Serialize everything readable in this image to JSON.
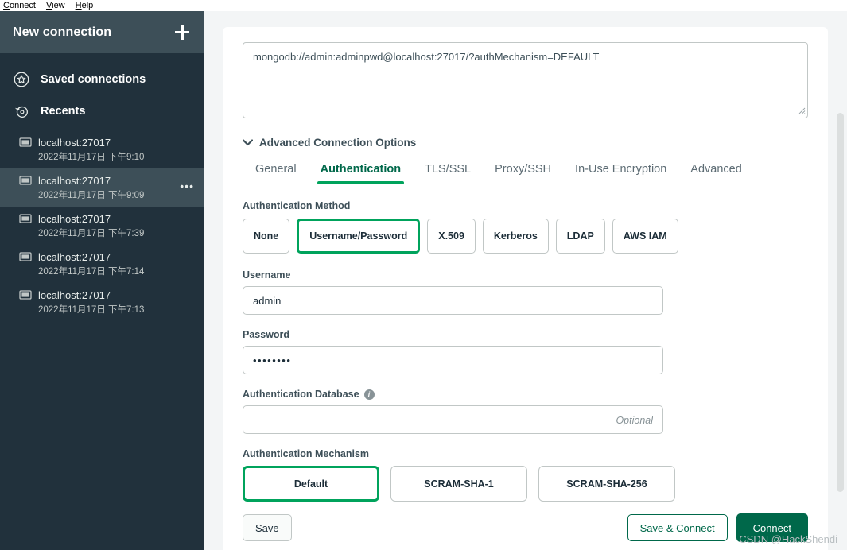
{
  "menubar": {
    "items": [
      {
        "mnemonic": "C",
        "rest": "onnect"
      },
      {
        "mnemonic": "V",
        "rest": "iew"
      },
      {
        "mnemonic": "H",
        "rest": "elp"
      }
    ]
  },
  "sidebar": {
    "header": {
      "title": "New connection",
      "add_icon": "plus-icon"
    },
    "sections": [
      {
        "label": "Saved connections",
        "icon": "star-circle-icon"
      },
      {
        "label": "Recents",
        "icon": "history-rewind-icon"
      }
    ],
    "recents": [
      {
        "name": "localhost:27017",
        "date": "2022年11月17日 下午9:10",
        "selected": false
      },
      {
        "name": "localhost:27017",
        "date": "2022年11月17日 下午9:09",
        "selected": true
      },
      {
        "name": "localhost:27017",
        "date": "2022年11月17日 下午7:39",
        "selected": false
      },
      {
        "name": "localhost:27017",
        "date": "2022年11月17日 下午7:14",
        "selected": false
      },
      {
        "name": "localhost:27017",
        "date": "2022年11月17日 下午7:13",
        "selected": false
      }
    ],
    "overflow_menu": "•••"
  },
  "main": {
    "connection_string": "mongodb://admin:adminpwd@localhost:27017/?authMechanism=DEFAULT",
    "advanced_toggle": {
      "label": "Advanced Connection Options",
      "icon": "chevron-down-icon",
      "expanded": true
    },
    "tabs": [
      {
        "label": "General",
        "active": false
      },
      {
        "label": "Authentication",
        "active": true
      },
      {
        "label": "TLS/SSL",
        "active": false
      },
      {
        "label": "Proxy/SSH",
        "active": false
      },
      {
        "label": "In-Use Encryption",
        "active": false
      },
      {
        "label": "Advanced",
        "active": false
      }
    ],
    "auth_method": {
      "label": "Authentication Method",
      "options": [
        {
          "label": "None",
          "selected": false
        },
        {
          "label": "Username/Password",
          "selected": true
        },
        {
          "label": "X.509",
          "selected": false
        },
        {
          "label": "Kerberos",
          "selected": false
        },
        {
          "label": "LDAP",
          "selected": false
        },
        {
          "label": "AWS IAM",
          "selected": false
        }
      ]
    },
    "username": {
      "label": "Username",
      "value": "admin",
      "placeholder": ""
    },
    "password": {
      "label": "Password",
      "value": "••••••••",
      "placeholder": ""
    },
    "auth_database": {
      "label": "Authentication Database",
      "value": "",
      "placeholder": "Optional",
      "info_icon": "info-icon"
    },
    "auth_mechanism": {
      "label": "Authentication Mechanism",
      "options": [
        {
          "label": "Default",
          "selected": true
        },
        {
          "label": "SCRAM-SHA-1",
          "selected": false
        },
        {
          "label": "SCRAM-SHA-256",
          "selected": false
        }
      ]
    },
    "footer": {
      "save": "Save",
      "save_and_connect": "Save & Connect",
      "connect": "Connect"
    }
  },
  "watermark": "CSDN @HackShendi",
  "colors": {
    "sidebar_bg": "#21313c",
    "sidebar_header_bg": "#3d4f58",
    "accent_green": "#00a35c",
    "dark_green": "#00684a",
    "page_bg": "#f3f5f6"
  }
}
